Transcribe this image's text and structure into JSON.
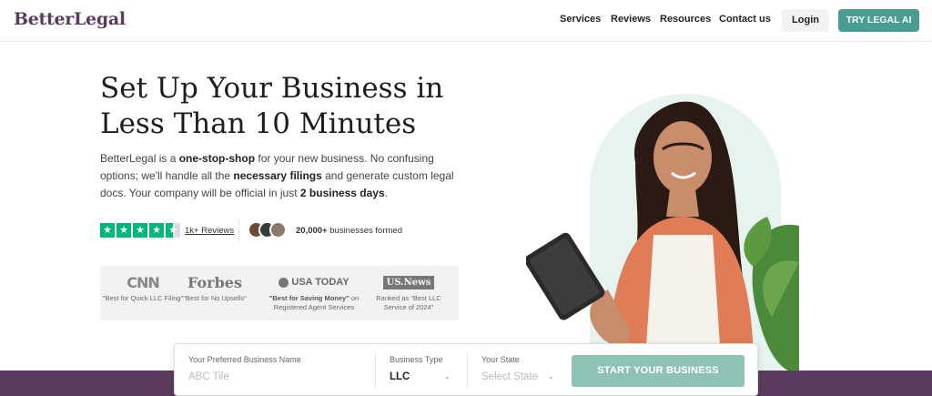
{
  "nav": {
    "logo": "BetterLegal",
    "links": [
      "Services",
      "Reviews",
      "Resources",
      "Contact us"
    ],
    "login": "Login",
    "cta": "TRY LEGAL AI"
  },
  "hero": {
    "title_line1": "Set Up Your Business in",
    "title_line2": "Less Than 10 Minutes",
    "desc": {
      "p1": "BetterLegal is a ",
      "b1": "one-stop-shop",
      "p2": " for your new business. No confusing options; we'll handle all the ",
      "b2": "necessary filings",
      "p3": " and generate custom legal docs. Your company will be official in just ",
      "b3": "2 business days",
      "p4": "."
    },
    "rating_stars": 4.5,
    "reviews_link": "1k+ Reviews",
    "businesses_count": "20,000+",
    "businesses_text": " businesses formed"
  },
  "press": [
    {
      "logo": "CNN",
      "caption": "\"Best for Quick LLC Filing\""
    },
    {
      "logo": "Forbes",
      "caption": "\"Best for No Upsells\""
    },
    {
      "logo": "USA TODAY",
      "caption_bold": "\"Best for Saving Money\"",
      "caption_rest": " on Registered Agent Services"
    },
    {
      "logo": "US.News",
      "caption": "Ranked as \"Best LLC Service of 2024\""
    }
  ],
  "form": {
    "name_label": "Your Preferred Business Name",
    "name_placeholder": "ABC Tile",
    "type_label": "Business Type",
    "type_value": "LLC",
    "state_label": "Your State",
    "state_placeholder": "Select State",
    "submit": "START YOUR BUSINESS"
  },
  "colors": {
    "brand": "#5b3b5e",
    "teal": "#4a9d93",
    "teal_light": "#8ec2b6",
    "trustpilot": "#00b67a"
  }
}
